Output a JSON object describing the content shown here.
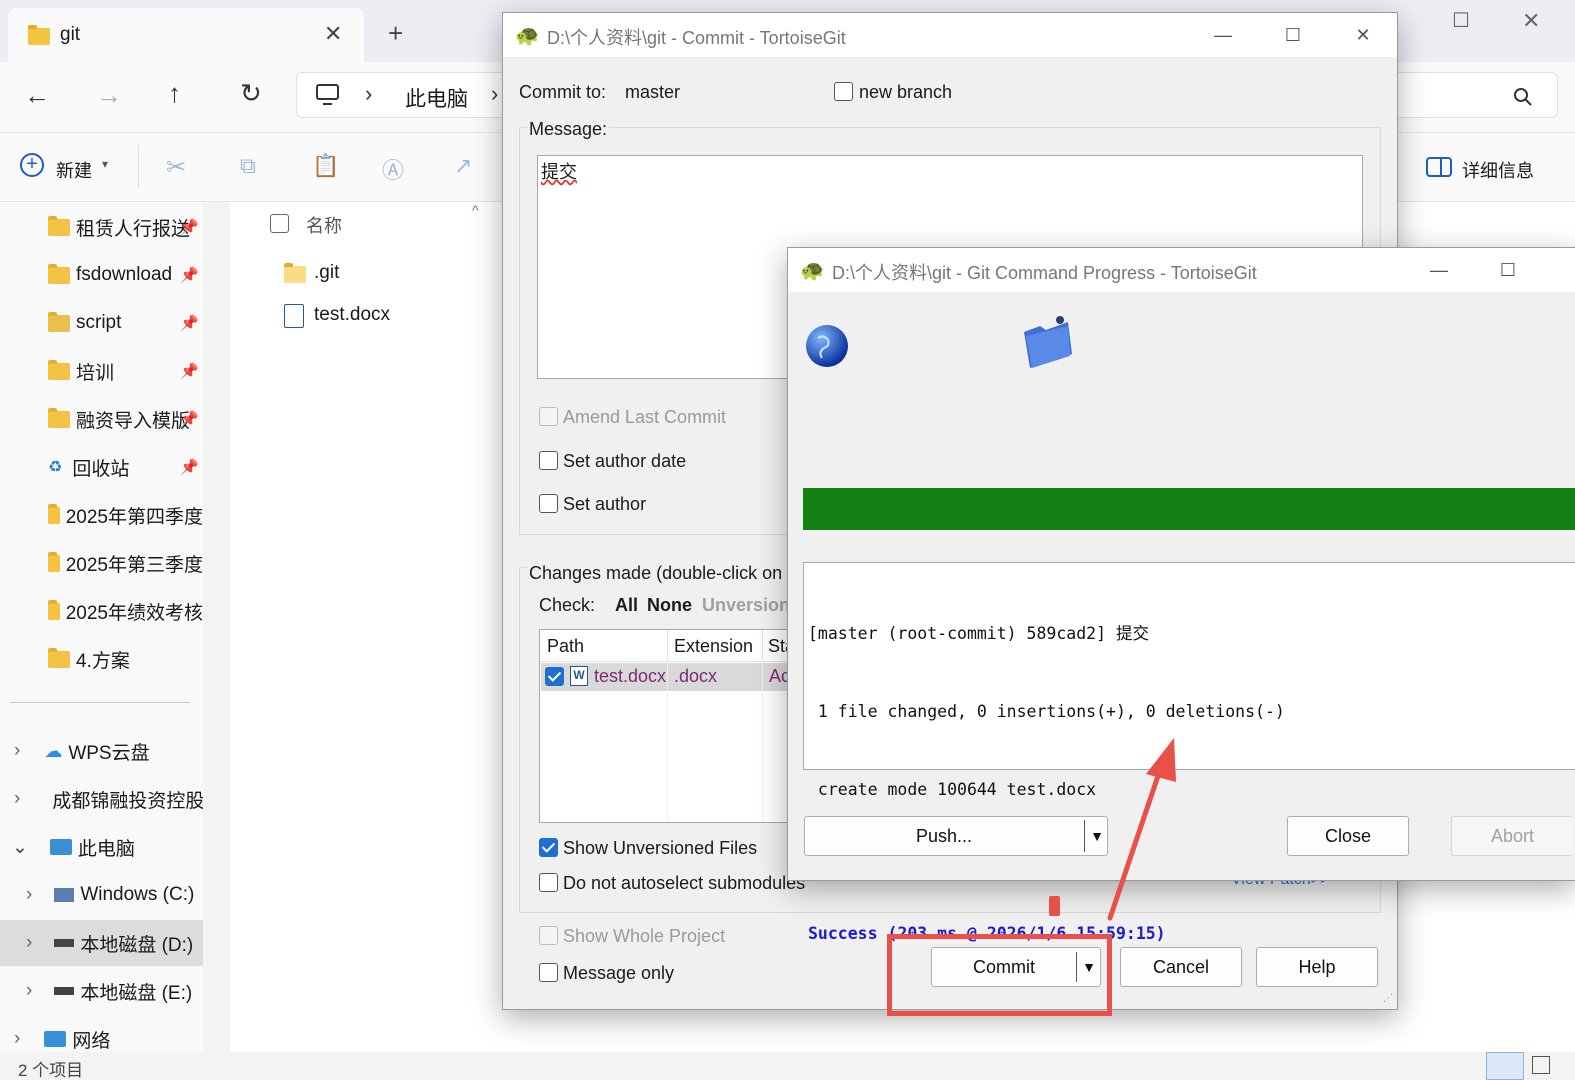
{
  "explorer": {
    "tab_title": "git",
    "address": {
      "root_label": "此电脑"
    },
    "toolbar": {
      "new_label": "新建",
      "details_label": "详细信息"
    },
    "nav_items": [
      {
        "label": "租赁人行报送"
      },
      {
        "label": "fsdownload"
      },
      {
        "label": "script"
      },
      {
        "label": "培训"
      },
      {
        "label": "融资导入模版"
      },
      {
        "label": "回收站"
      },
      {
        "label": "2025年第四季度"
      },
      {
        "label": "2025年第三季度"
      },
      {
        "label": "2025年绩效考核"
      },
      {
        "label": "4.方案"
      },
      {
        "label": "WPS云盘"
      },
      {
        "label": "成都锦融投资控股"
      },
      {
        "label": "此电脑"
      },
      {
        "label": "Windows (C:)"
      },
      {
        "label": "本地磁盘 (D:)"
      },
      {
        "label": "本地磁盘 (E:)"
      },
      {
        "label": "网络"
      }
    ],
    "column_name": "名称",
    "files": [
      {
        "name": ".git"
      },
      {
        "name": "test.docx"
      }
    ],
    "status": "2 个项目"
  },
  "commit_dialog": {
    "title": "D:\\个人资料\\git - Commit - TortoiseGit",
    "commit_to_label": "Commit to:",
    "branch": "master",
    "new_branch_label": "new branch",
    "message_label": "Message:",
    "message_text": "提交",
    "amend_label": "Amend Last Commit",
    "set_author_date_label": "Set author date",
    "set_author_label": "Set author",
    "changes_label": "Changes made (double-click on f",
    "check_label": "Check:",
    "check_all": "All",
    "check_none": "None",
    "check_unversioned": "Unversion",
    "columns": {
      "path": "Path",
      "extension": "Extension",
      "status": "Sta"
    },
    "file_row": {
      "path": "test.docx",
      "extension": ".docx",
      "status": "Ac"
    },
    "show_unversioned_label": "Show Unversioned Files",
    "no_autoselect_label": "Do not autoselect submodules",
    "view_patch_label": "View Patch>>",
    "show_whole_project_label": "Show Whole Project",
    "message_only_label": "Message only",
    "commit_button": "Commit",
    "cancel_button": "Cancel",
    "help_button": "Help"
  },
  "progress_dialog": {
    "title": "D:\\个人资料\\git - Git Command Progress - TortoiseGit",
    "progress": 1.0,
    "progress_color": "#138013",
    "log_lines": [
      "[master (root-commit) 589cad2] 提交",
      " 1 file changed, 0 insertions(+), 0 deletions(-)",
      " create mode 100644 test.docx"
    ],
    "success_line": "Success (203 ms @ 2026/1/6 15:59:15)",
    "push_button": "Push...",
    "close_button": "Close",
    "abort_button": "Abort"
  },
  "annotation": {
    "highlight_color": "#e8504a"
  }
}
